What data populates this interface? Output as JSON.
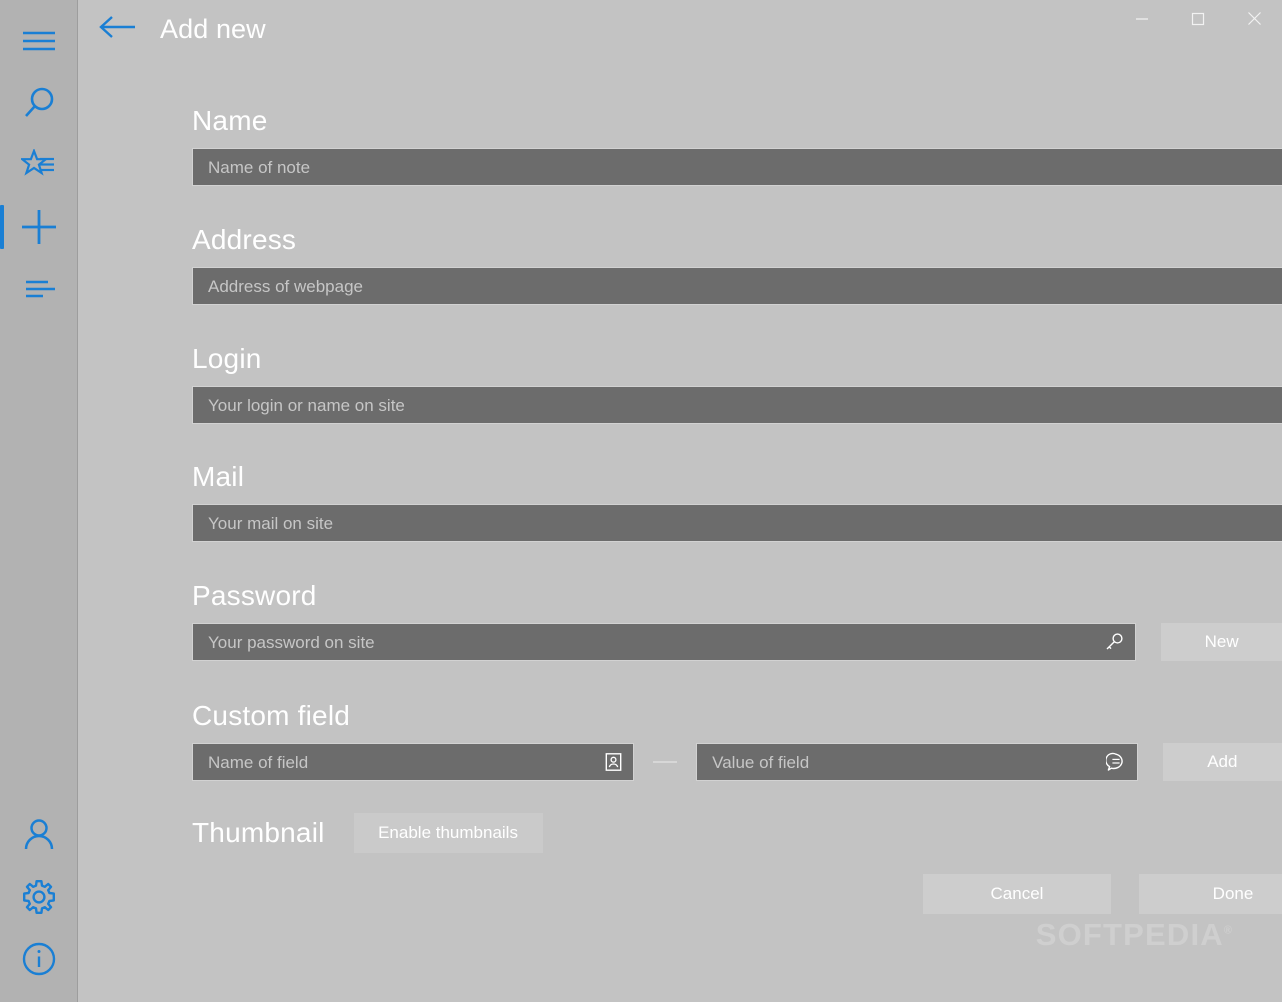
{
  "window": {
    "title": "Add new",
    "back_icon": "back-arrow-icon",
    "minimize_label": "─",
    "maximize_label": "□",
    "close_label": "✕"
  },
  "sidebar": {
    "items": [
      {
        "name": "menu",
        "icon": "hamburger-menu-icon",
        "selected": false
      },
      {
        "name": "search",
        "icon": "search-icon",
        "selected": false
      },
      {
        "name": "favorites",
        "icon": "star-list-icon",
        "selected": false
      },
      {
        "name": "add",
        "icon": "plus-icon",
        "selected": true
      },
      {
        "name": "notes",
        "icon": "list-lines-icon",
        "selected": false
      }
    ],
    "bottom_items": [
      {
        "name": "account",
        "icon": "person-icon"
      },
      {
        "name": "settings",
        "icon": "gear-icon"
      },
      {
        "name": "about",
        "icon": "info-circle-icon"
      }
    ]
  },
  "form": {
    "name": {
      "label": "Name",
      "placeholder": "Name of note",
      "value": "",
      "icon": "home-icon"
    },
    "address": {
      "label": "Address",
      "placeholder": "Address of webpage",
      "value": "",
      "icon": "globe-icon"
    },
    "login": {
      "label": "Login",
      "placeholder": "Your login or name on site",
      "value": "",
      "icon": "person-icon"
    },
    "mail": {
      "label": "Mail",
      "placeholder": "Your mail on site",
      "value": "",
      "icon": "at-sign-icon"
    },
    "password": {
      "label": "Password",
      "placeholder": "Your password on site",
      "value": "",
      "icon": "key-icon",
      "new_button": "New"
    },
    "custom_field": {
      "label": "Custom field",
      "name_placeholder": "Name of field",
      "name_value": "",
      "name_icon": "contact-card-icon",
      "separator": "—",
      "value_placeholder": "Value of field",
      "value_value": "",
      "value_icon": "speech-bubble-icon",
      "add_button": "Add"
    },
    "thumbnail": {
      "label": "Thumbnail",
      "button": "Enable thumbnails"
    }
  },
  "footer": {
    "cancel": "Cancel",
    "done": "Done"
  },
  "watermark": {
    "text": "SOFTPEDIA",
    "mark": "®"
  },
  "colors": {
    "accent": "#1a7fd4",
    "background": "#c3c3c3",
    "sidebar": "#b2b2b2",
    "input": "#6c6c6c",
    "button": "#cdcdcd",
    "text": "#ffffff",
    "placeholder": "#c6c6c6"
  }
}
